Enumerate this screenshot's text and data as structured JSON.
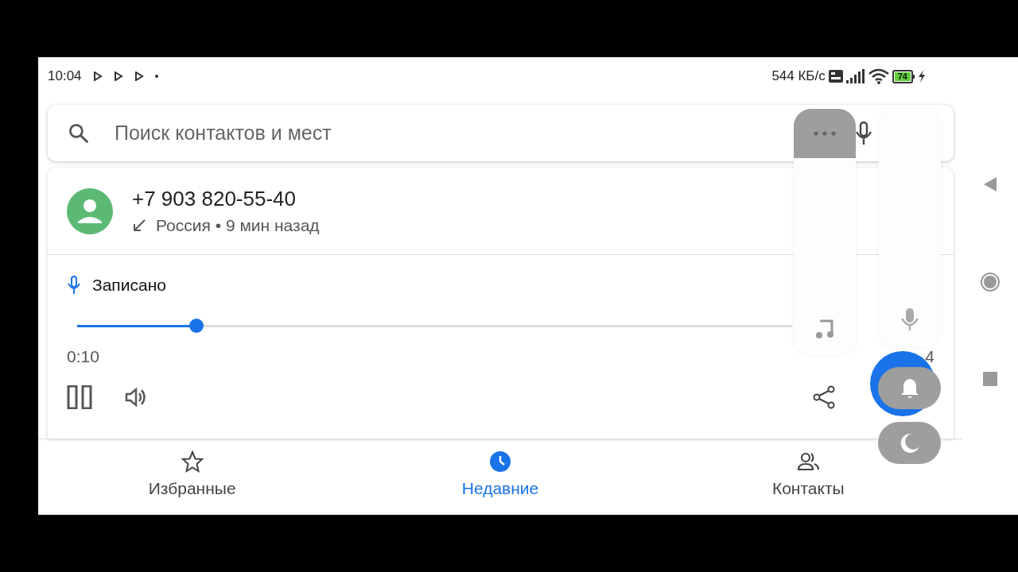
{
  "status_bar": {
    "time": "10:04",
    "network_speed": "544 КБ/с",
    "battery": "74"
  },
  "search": {
    "placeholder": "Поиск контактов и мест"
  },
  "call": {
    "number": "+7 903 820-55-40",
    "details": "Россия • 9 мин назад"
  },
  "recording": {
    "label": "Записано",
    "level": 0.167,
    "elapsed": "0:10",
    "duration": "4"
  },
  "volume_panel": {
    "media": {
      "level": 0
    },
    "call": {
      "level": 0
    }
  },
  "bottom_nav": [
    {
      "kind": "star",
      "label": "Избранные",
      "selected": false
    },
    {
      "kind": "clock",
      "label": "Недавние",
      "selected": true
    },
    {
      "kind": "people",
      "label": "Контакты",
      "selected": false
    }
  ]
}
